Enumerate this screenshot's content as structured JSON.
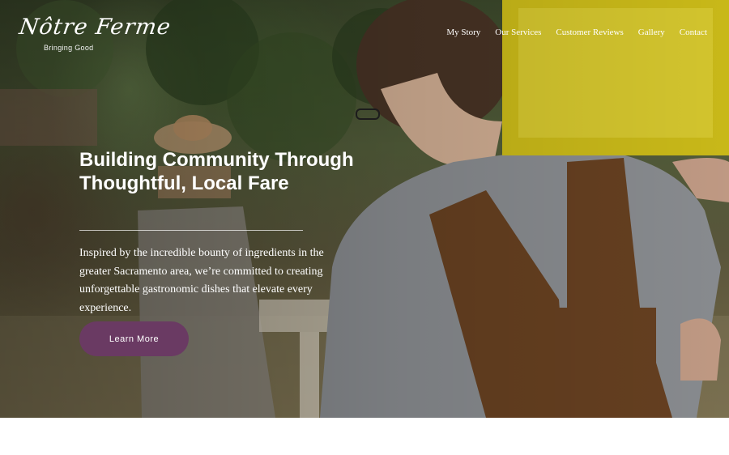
{
  "brand": {
    "logo_script": "Nôtre Ferme",
    "logo_tagline": "Bringing Good"
  },
  "nav": {
    "items": [
      {
        "label": "My Story"
      },
      {
        "label": "Our Services"
      },
      {
        "label": "Customer Reviews"
      },
      {
        "label": "Gallery"
      },
      {
        "label": "Contact"
      }
    ]
  },
  "hero": {
    "headline": "Building Community Through Thoughtful, Local Fare",
    "intro": "Inspired by the incredible bounty of ingredients in the greater Sacramento area, we’re committed to creating unforgettable gastronomic dishes that elevate every experience.",
    "cta_label": "Learn More"
  },
  "colors": {
    "cta_background": "#6a3a63",
    "text": "#ffffff"
  }
}
